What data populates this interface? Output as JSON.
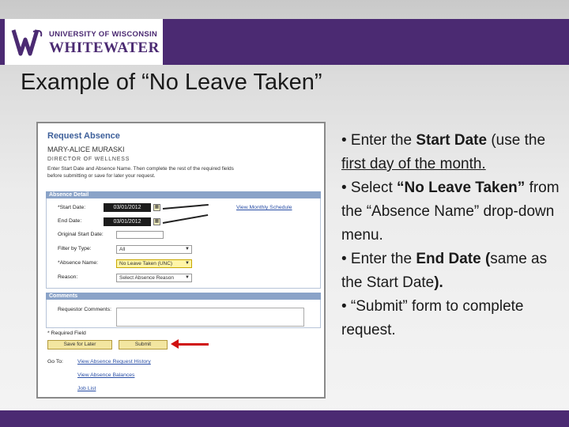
{
  "header": {
    "logo_line1": "UNIVERSITY OF WISCONSIN",
    "logo_line2": "WHITEWATER",
    "brand_color": "#4b2a72"
  },
  "slide": {
    "title": "Example of “No Leave Taken”"
  },
  "form": {
    "title": "Request Absence",
    "employee_name": "MARY-ALICE MURASKI",
    "department": "DIRECTOR OF WELLNESS",
    "instructions_1": "Enter Start Date and Absence Name. Then complete the rest of the required fields",
    "instructions_2": "before submitting or save for later your request.",
    "absence_detail_header": "Absence Detail",
    "start_date_label": "*Start Date:",
    "start_date_value": "03/01/2012",
    "end_date_label": "End Date:",
    "end_date_value": "03/01/2012",
    "original_start_label": "Original Start Date:",
    "filter_label": "Filter by Type:",
    "filter_value": "All",
    "absence_name_label": "*Absence Name:",
    "absence_name_value": "No Leave Taken (UNC)",
    "reason_label": "Reason:",
    "reason_value": "Select Absence Reason",
    "view_monthly_link": "View Monthly Schedule",
    "comments_header": "Comments",
    "requestor_comments_label": "Requestor Comments:",
    "required_field_note": "* Required Field",
    "save_for_later_button": "Save for Later",
    "submit_button": "Submit",
    "goto_label": "Go To:",
    "goto_link_1": "View Absence Request History",
    "goto_link_2": "View Absence Balances",
    "goto_link_3": "Job List"
  },
  "bullets": {
    "b1_pre": "• Enter the ",
    "b1_bold": "Start Date",
    "b1_mid": " (use the ",
    "b1_underline": "first day of the month.",
    "b2_pre": "• Select ",
    "b2_bold": "“No Leave Taken”",
    "b2_post": " from the “Absence Name” drop-down menu.",
    "b3_pre": "• Enter the ",
    "b3_bold": "End Date",
    "b3_open": "(",
    "b3_mid": "same as the Start Date",
    "b3_close": ").",
    "b4": "• “Submit” form to complete request."
  }
}
